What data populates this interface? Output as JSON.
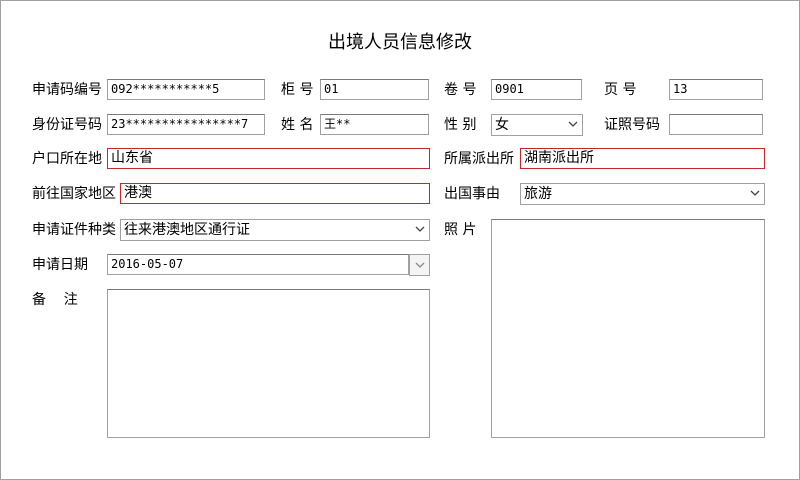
{
  "form": {
    "title": "出境人员信息修改",
    "application_code": {
      "label": "申请码编号",
      "value": "092***********5"
    },
    "cabinet_no": {
      "label": "柜 号",
      "value": "01"
    },
    "volume_no": {
      "label": "卷 号",
      "value": "0901"
    },
    "page_no": {
      "label": "页 号",
      "value": "13"
    },
    "id_number": {
      "label": "身份证号码",
      "value": "23****************7"
    },
    "name": {
      "label": "姓 名",
      "value": "王**"
    },
    "gender": {
      "label": "性 别",
      "value": "女"
    },
    "cert_number": {
      "label": "证照号码",
      "value": ""
    },
    "hukou": {
      "label": "户口所在地",
      "value": "山东省"
    },
    "police_station": {
      "label": "所属派出所",
      "value": "湖南派出所"
    },
    "destination": {
      "label": "前往国家地区",
      "value": "港澳"
    },
    "exit_reason": {
      "label": "出国事由",
      "value": "旅游"
    },
    "cert_type": {
      "label": "申请证件种类",
      "value": "往来港澳地区通行证"
    },
    "photo": {
      "label": "照 片"
    },
    "apply_date": {
      "label": "申请日期",
      "value": "2016-05-07"
    },
    "remarks": {
      "label": "备    注",
      "value": ""
    }
  },
  "colors": {
    "required_border": "#c0282e",
    "field_border": "#a0a0a0"
  }
}
